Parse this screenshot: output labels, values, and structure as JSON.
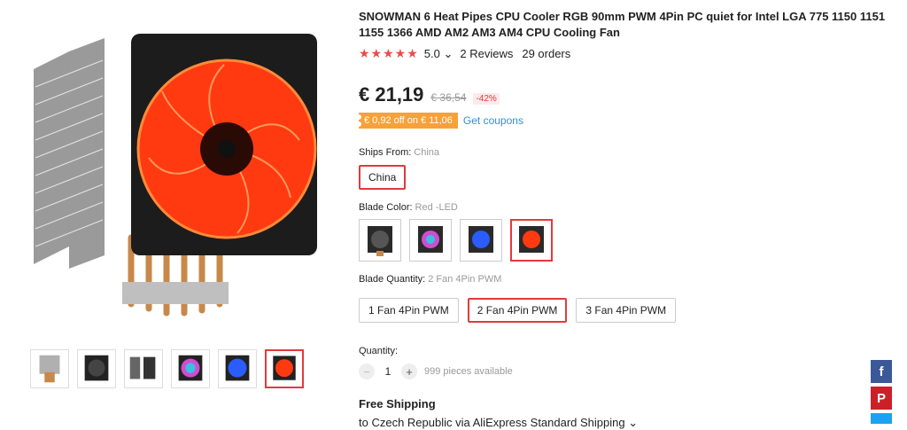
{
  "product": {
    "title": "SNOWMAN 6 Heat Pipes CPU Cooler RGB 90mm PWM 4Pin PC quiet for Intel LGA 775 1150 1151 1155 1366 AMD AM2 AM3 AM4 CPU Cooling Fan",
    "stars": "★★★★★",
    "rating": "5.0",
    "rating_chevron": "⌄",
    "reviews": "2 Reviews",
    "orders": "29 orders"
  },
  "price": {
    "current": "€ 21,19",
    "old": "€ 36,54",
    "discount": "-42%"
  },
  "coupon": {
    "text": "€ 0,92 off on € 11,06",
    "link": "Get coupons"
  },
  "ships_from": {
    "label": "Ships From:",
    "value": "China",
    "option": "China"
  },
  "blade_color": {
    "label": "Blade Color:",
    "value": "Red -LED",
    "options": [
      "Black",
      "RGB",
      "Blue",
      "Red"
    ],
    "selected": 3
  },
  "blade_quantity": {
    "label": "Blade Quantity:",
    "value": "2 Fan 4Pin PWM",
    "options": [
      "1 Fan 4Pin PWM",
      "2 Fan 4Pin PWM",
      "3 Fan 4Pin PWM"
    ],
    "selected": 1
  },
  "quantity": {
    "label": "Quantity:",
    "value": "1",
    "minus": "−",
    "plus": "+",
    "available": "999 pieces available"
  },
  "shipping": {
    "title": "Free Shipping",
    "detail": "to Czech Republic via AliExpress Standard Shipping ⌄"
  },
  "gallery": {
    "thumbnail_count": 6,
    "selected_thumbnail": 5
  },
  "social": {
    "facebook": "f",
    "pinterest": "P"
  },
  "colors": {
    "accent_red": "#e4393c",
    "coupon_orange": "#f7a13b",
    "link_blue": "#2f8fd8",
    "star_red": "#f04949"
  }
}
